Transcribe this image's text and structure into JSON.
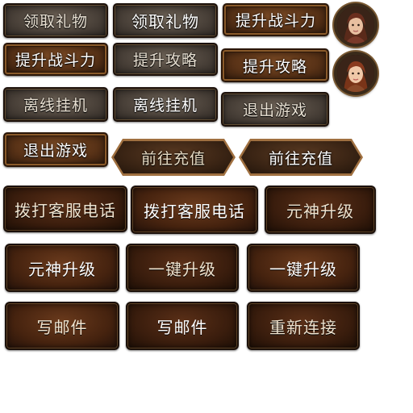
{
  "buttons": {
    "receive_gift": "领取礼物",
    "boost_power": "提升战斗力",
    "boost_guide": "提升攻略",
    "offline_idle": "离线挂机",
    "quit_game": "退出游戏",
    "recharge": "前往充值",
    "call_service": "拨打客服电话",
    "spirit_upgrade": "元神升级",
    "one_key_upgrade": "一键升级",
    "write_mail": "写邮件",
    "reconnect": "重新连接"
  },
  "avatar": {
    "icon": "hero-portrait-icon"
  }
}
